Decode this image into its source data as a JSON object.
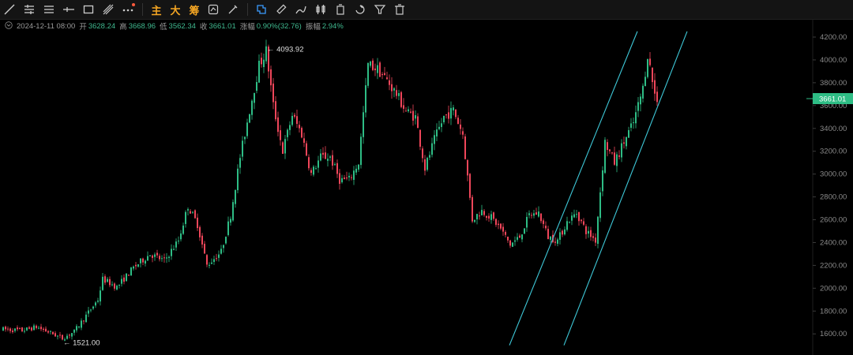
{
  "toolbar": {
    "tools": [
      "line-tool-icon",
      "horizontal-lines-icon",
      "channel-icon",
      "horizontal-ray-icon",
      "rectangle-icon",
      "fib-icon",
      "more-icon"
    ],
    "text_buttons": [
      "主",
      "大",
      "筹"
    ],
    "tools2": [
      "adjust-icon",
      "brush-icon"
    ],
    "tools3": [
      "measure-icon",
      "ruler-icon",
      "pencil-icon",
      "candles-icon",
      "copy-icon",
      "magnet-icon",
      "filter-icon",
      "trash-icon"
    ]
  },
  "info": {
    "date": "2024-12-11 08:00",
    "open_label": "开",
    "open": "3628.24",
    "high_label": "高",
    "high": "3668.96",
    "low_label": "低",
    "low": "3562.34",
    "close_label": "收",
    "close": "3661.01",
    "change_label": "涨幅",
    "change": "0.90%(32.76)",
    "amplitude_label": "振幅",
    "amplitude": "2.94%"
  },
  "colors": {
    "up": "#2ebd85",
    "down": "#f0465a",
    "channel": "#3ec8d8",
    "price_tag": "#2ebd85",
    "axis_text": "#8a8a8a"
  },
  "chart_data": {
    "type": "candlestick",
    "ylim": [
      1500,
      4250
    ],
    "ytick_labels": [
      "4200.00",
      "4000.00",
      "3800.00",
      "3600.00",
      "3400.00",
      "3200.00",
      "3000.00",
      "2800.00",
      "2600.00",
      "2400.00",
      "2200.00",
      "2000.00",
      "1800.00",
      "1600.00"
    ],
    "current_price_label": "3661.01",
    "annotations": [
      {
        "text": "← 4093.92",
        "price": 4093.92,
        "index": 111
      },
      {
        "text": "← 1521.00",
        "price": 1521.0,
        "index": 25
      }
    ],
    "channel_lines": [
      {
        "x": [
          214,
          268
        ],
        "y": [
          1500,
          4250
        ]
      },
      {
        "x": [
          237,
          289
        ],
        "y": [
          1500,
          4250
        ]
      }
    ],
    "close_path": [
      [
        0,
        1640
      ],
      [
        8,
        1630
      ],
      [
        14,
        1660
      ],
      [
        20,
        1610
      ],
      [
        25,
        1560
      ],
      [
        30,
        1620
      ],
      [
        35,
        1760
      ],
      [
        40,
        1900
      ],
      [
        42,
        2080
      ],
      [
        48,
        2010
      ],
      [
        55,
        2180
      ],
      [
        62,
        2300
      ],
      [
        68,
        2240
      ],
      [
        74,
        2420
      ],
      [
        78,
        2720
      ],
      [
        82,
        2560
      ],
      [
        86,
        2200
      ],
      [
        92,
        2320
      ],
      [
        96,
        2640
      ],
      [
        100,
        3150
      ],
      [
        104,
        3560
      ],
      [
        108,
        3950
      ],
      [
        111,
        4080
      ],
      [
        114,
        3600
      ],
      [
        118,
        3200
      ],
      [
        122,
        3520
      ],
      [
        126,
        3350
      ],
      [
        130,
        3000
      ],
      [
        134,
        3150
      ],
      [
        138,
        3150
      ],
      [
        142,
        2950
      ],
      [
        146,
        2950
      ],
      [
        150,
        3100
      ],
      [
        154,
        3960
      ],
      [
        158,
        3920
      ],
      [
        162,
        3820
      ],
      [
        166,
        3700
      ],
      [
        170,
        3550
      ],
      [
        174,
        3500
      ],
      [
        178,
        3050
      ],
      [
        182,
        3300
      ],
      [
        186,
        3500
      ],
      [
        190,
        3560
      ],
      [
        194,
        3350
      ],
      [
        198,
        2600
      ],
      [
        202,
        2680
      ],
      [
        206,
        2620
      ],
      [
        210,
        2520
      ],
      [
        214,
        2380
      ],
      [
        218,
        2450
      ],
      [
        222,
        2640
      ],
      [
        226,
        2660
      ],
      [
        230,
        2450
      ],
      [
        234,
        2420
      ],
      [
        238,
        2580
      ],
      [
        242,
        2660
      ],
      [
        246,
        2500
      ],
      [
        250,
        2420
      ],
      [
        254,
        3280
      ],
      [
        258,
        3100
      ],
      [
        262,
        3280
      ],
      [
        266,
        3450
      ],
      [
        270,
        3750
      ],
      [
        272,
        4050
      ],
      [
        275,
        3700
      ],
      [
        276,
        3661
      ]
    ],
    "n_candles": 277,
    "x_range": [
      0,
      280
    ]
  }
}
